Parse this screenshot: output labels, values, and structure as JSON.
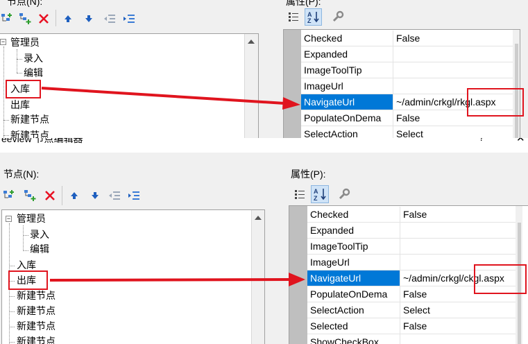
{
  "top": {
    "nodes_label": "节点(N):",
    "props_label": "属性(P):",
    "tree": [
      "管理员",
      "录入",
      "编辑",
      "入库",
      "出库",
      "新建节点",
      "新建节点"
    ],
    "props": [
      {
        "name": "Checked",
        "value": "False"
      },
      {
        "name": "Expanded",
        "value": ""
      },
      {
        "name": "ImageToolTip",
        "value": ""
      },
      {
        "name": "ImageUrl",
        "value": ""
      },
      {
        "name": "NavigateUrl",
        "value": "~/admin/crkgl/rkgl.aspx"
      },
      {
        "name": "PopulateOnDema",
        "value": "False"
      },
      {
        "name": "SelectAction",
        "value": "Select"
      }
    ]
  },
  "strip": {
    "title": "eeview 节点编辑器",
    "help": "?",
    "close": "✕"
  },
  "bottom": {
    "nodes_label": "节点(N):",
    "props_label": "属性(P):",
    "tree": [
      "管理员",
      "录入",
      "编辑",
      "入库",
      "出库",
      "新建节点",
      "新建节点",
      "新建节点",
      "新建节点"
    ],
    "props": [
      {
        "name": "Checked",
        "value": "False"
      },
      {
        "name": "Expanded",
        "value": ""
      },
      {
        "name": "ImageToolTip",
        "value": ""
      },
      {
        "name": "ImageUrl",
        "value": ""
      },
      {
        "name": "NavigateUrl",
        "value": "~/admin/crkgl/ckgl.aspx"
      },
      {
        "name": "PopulateOnDema",
        "value": "False"
      },
      {
        "name": "SelectAction",
        "value": "Select"
      },
      {
        "name": "Selected",
        "value": "False"
      },
      {
        "name": "ShowCheckBox",
        "value": ""
      }
    ]
  },
  "icons": {
    "add_root": "add-root-node-icon",
    "add_child": "add-child-node-icon",
    "delete": "delete-node-icon",
    "move_up": "move-up-icon",
    "move_down": "move-down-icon",
    "outdent": "outdent-icon",
    "indent": "indent-icon",
    "categorized": "categorized-view-icon",
    "alphabetical": "alphabetical-view-icon",
    "property_pages": "property-pages-icon"
  },
  "colors": {
    "selection": "#0078d7",
    "annotation": "#e0141e",
    "gutter": "#bfbfbf"
  }
}
